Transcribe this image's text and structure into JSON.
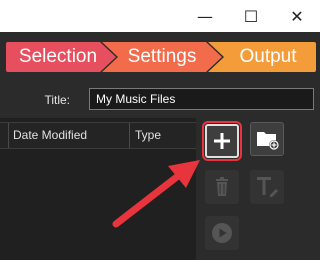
{
  "window": {
    "minimize_glyph": "—",
    "maximize_glyph": "☐",
    "close_glyph": "✕"
  },
  "steps": [
    {
      "label": "Selection",
      "color": "#e84f5e"
    },
    {
      "label": "Settings",
      "color": "#f26b4a"
    },
    {
      "label": "Output",
      "color": "#f59c3a"
    }
  ],
  "title_field": {
    "label": "Title:",
    "value": "My Music Files"
  },
  "file_list": {
    "columns": [
      "Date Modified",
      "Type"
    ]
  },
  "side_buttons": [
    {
      "name": "add",
      "icon": "plus-icon",
      "enabled": true
    },
    {
      "name": "add-folder",
      "icon": "folder-add-icon",
      "enabled": true
    },
    {
      "name": "delete",
      "icon": "trash-icon",
      "enabled": false
    },
    {
      "name": "rename",
      "icon": "text-edit-icon",
      "enabled": false
    },
    {
      "name": "play",
      "icon": "play-icon",
      "enabled": false
    }
  ],
  "colors": {
    "background": "#2b2b2b",
    "list_background": "#202020",
    "highlight_red": "#e8343c"
  }
}
